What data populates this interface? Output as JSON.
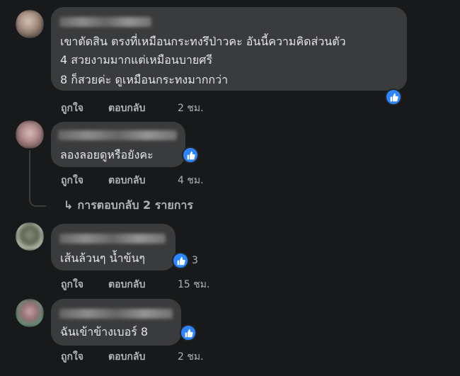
{
  "colors": {
    "background": "#18191a",
    "bubble": "#3a3b3c",
    "text": "#e4e6eb",
    "secondary_text": "#b0b3b8",
    "like_blue": "#2d86ff"
  },
  "comments": [
    {
      "text_lines": [
        "เขาตัดสิน ตรงที่เหมือนกระทงรึป่าวคะ อันนี้ความคิดส่วนตัว",
        "4 สวยงามมากแต่เหมือนบายศรี",
        "8 ก็สวยค่ะ ดูเหมือนกระทงมากกว่า"
      ],
      "reaction_icon": "like-icon",
      "like_label": "ถูกใจ",
      "reply_label": "ตอบกลับ",
      "time": "2 ชม."
    },
    {
      "text_lines": [
        "ลองลอยดูหรือยังคะ"
      ],
      "reaction_icon": "like-icon",
      "like_label": "ถูกใจ",
      "reply_label": "ตอบกลับ",
      "time": "4 ชม.",
      "replies_link": "การตอบกลับ 2 รายการ"
    },
    {
      "text_lines": [
        "เส้นล้วนๆ น้ำข้นๆ"
      ],
      "reaction_icon": "like-icon",
      "reaction_count": "3",
      "like_label": "ถูกใจ",
      "reply_label": "ตอบกลับ",
      "time": "15 ชม."
    },
    {
      "text_lines": [
        "ฉันเข้าข้างเบอร์ 8"
      ],
      "reaction_icon": "like-icon",
      "like_label": "ถูกใจ",
      "reply_label": "ตอบกลับ",
      "time": "2 ชม."
    }
  ]
}
